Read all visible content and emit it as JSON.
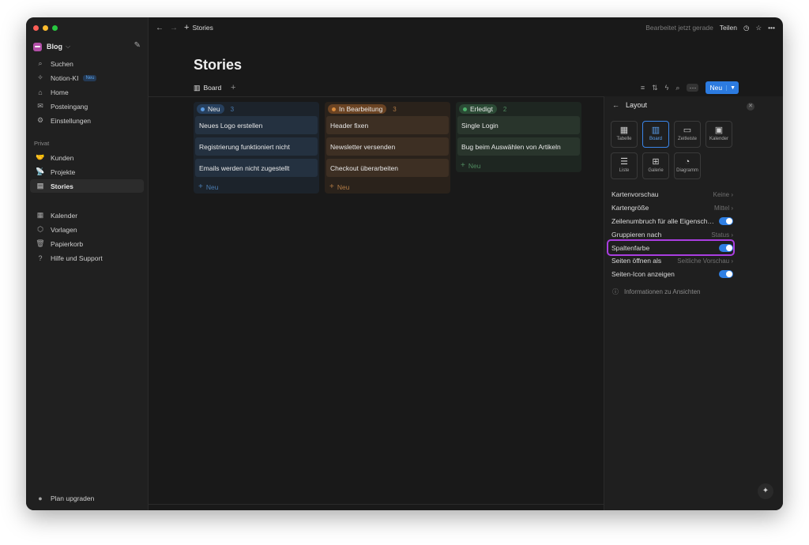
{
  "app": {
    "breadcrumb": "Stories",
    "edited": "Bearbeitet jetzt gerade",
    "share_label": "Teilen"
  },
  "sidebar": {
    "workspace": "Blog",
    "items": [
      {
        "label": "Suchen",
        "icon": "search-icon"
      },
      {
        "label": "Notion-KI",
        "icon": "sparkle-icon",
        "badge": "Neu"
      },
      {
        "label": "Home",
        "icon": "home-icon"
      },
      {
        "label": "Posteingang",
        "icon": "inbox-icon"
      },
      {
        "label": "Einstellungen",
        "icon": "gear-icon"
      }
    ],
    "section_label": "Privat",
    "private_items": [
      {
        "label": "Kunden",
        "icon": "handshake-icon"
      },
      {
        "label": "Projekte",
        "icon": "satellite-icon"
      },
      {
        "label": "Stories",
        "icon": "page-icon",
        "active": true
      }
    ],
    "bottom_items": [
      {
        "label": "Kalender",
        "icon": "calendar-icon"
      },
      {
        "label": "Vorlagen",
        "icon": "templates-icon"
      },
      {
        "label": "Papierkorb",
        "icon": "trash-icon"
      },
      {
        "label": "Hilfe und Support",
        "icon": "help-icon"
      }
    ],
    "upgrade": "Plan upgraden"
  },
  "page": {
    "title": "Stories",
    "view_tab": "Board",
    "new_button": "Neu"
  },
  "board": {
    "columns": [
      {
        "name": "Neu",
        "count": "3",
        "color": "#3b82c4",
        "cards": [
          "Neues Logo erstellen",
          "Registrierung funktioniert nicht",
          "Emails werden nicht zugestellt"
        ],
        "new_label": "Neu"
      },
      {
        "name": "In Bearbeitung",
        "count": "3",
        "color": "#c47a35",
        "cards": [
          "Header fixen",
          "Newsletter versenden",
          "Checkout überarbeiten"
        ],
        "new_label": "Neu"
      },
      {
        "name": "Erledigt",
        "count": "2",
        "color": "#3f9a5e",
        "cards": [
          "Single Login",
          "Bug beim Auswählen von Artikeln"
        ],
        "new_label": "Neu"
      }
    ]
  },
  "layout_panel": {
    "title": "Layout",
    "options": [
      {
        "label": "Tabelle",
        "icon": "table-icon"
      },
      {
        "label": "Board",
        "icon": "board-icon",
        "selected": true
      },
      {
        "label": "Zeitleiste",
        "icon": "timeline-icon"
      },
      {
        "label": "Kalender",
        "icon": "calendar-icon"
      },
      {
        "label": "Liste",
        "icon": "list-icon"
      },
      {
        "label": "Galerie",
        "icon": "gallery-icon"
      },
      {
        "label": "Diagramm",
        "icon": "chart-icon"
      }
    ],
    "settings": [
      {
        "label": "Kartenvorschau",
        "value": "Keine"
      },
      {
        "label": "Kartengröße",
        "value": "Mittel"
      },
      {
        "label": "Zeilenumbruch für alle Eigensch…",
        "toggle": true
      },
      {
        "label": "Gruppieren nach",
        "value": "Status"
      },
      {
        "label": "Spaltenfarbe",
        "toggle": true
      },
      {
        "label": "Seiten öffnen als",
        "value": "Seitliche Vorschau"
      },
      {
        "label": "Seiten-Icon anzeigen",
        "toggle": true
      }
    ],
    "info": "Informationen zu Ansichten"
  },
  "colors": {
    "accent": "#2c7be0",
    "highlight": "#a93ee0"
  }
}
